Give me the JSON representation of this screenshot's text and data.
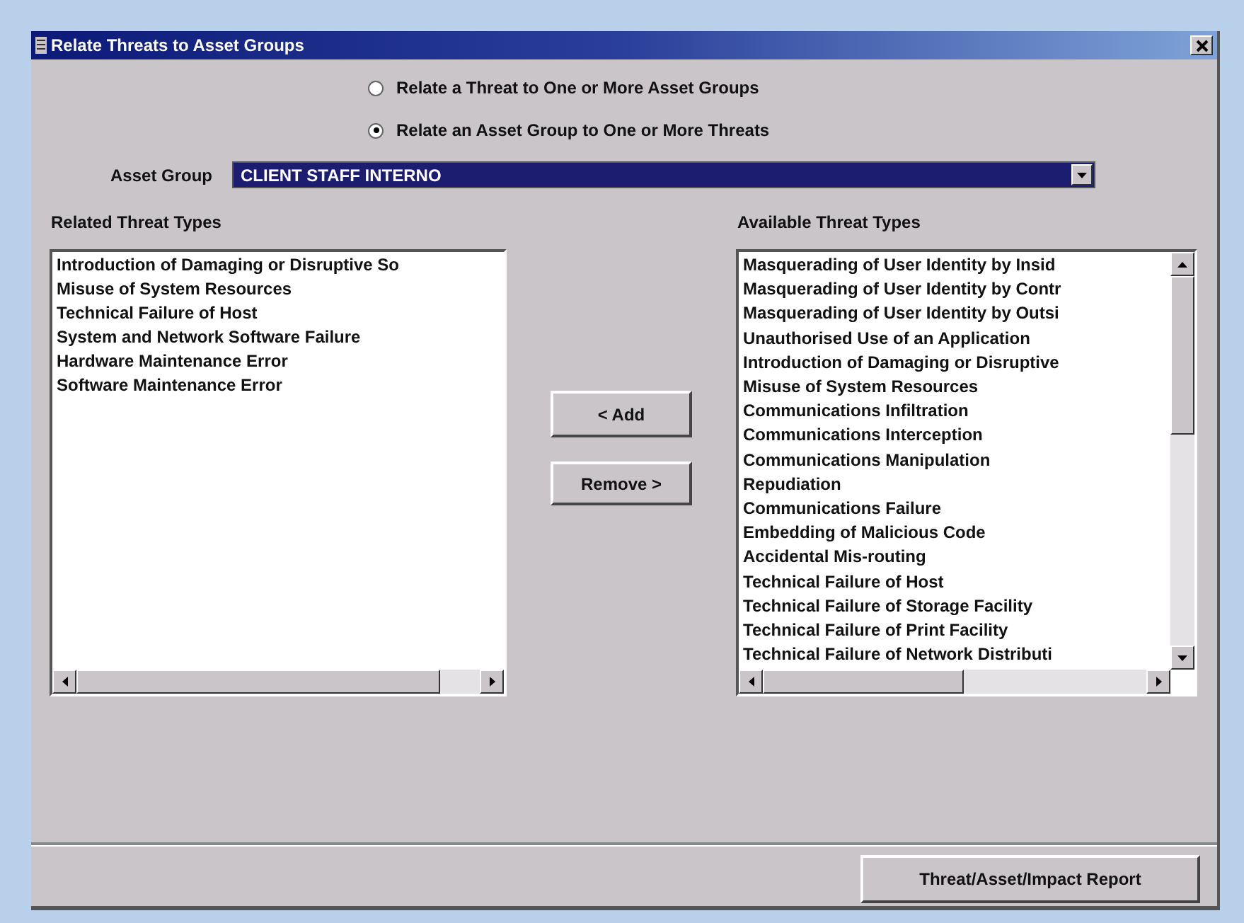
{
  "window": {
    "title": "Relate Threats to Asset Groups"
  },
  "modes": [
    {
      "label": "Relate a Threat to One or More Asset Groups",
      "selected": false
    },
    {
      "label": "Relate an Asset Group to One or More Threats",
      "selected": true
    }
  ],
  "asset_group": {
    "label": "Asset Group",
    "value": "CLIENT STAFF INTERNO"
  },
  "related": {
    "heading": "Related Threat Types",
    "items": [
      "Introduction of Damaging or Disruptive So",
      "Misuse of System Resources",
      "Technical Failure of Host",
      "System and Network Software Failure",
      "Hardware Maintenance Error",
      "Software Maintenance Error"
    ]
  },
  "actions": [
    "< Add",
    "Remove >"
  ],
  "available": {
    "heading": "Available Threat Types",
    "items": [
      "Masquerading of User Identity by Insid",
      "Masquerading of User Identity by Contr",
      "Masquerading of User Identity by Outsi",
      "Unauthorised Use of an Application",
      "Introduction of Damaging or Disruptive",
      "Misuse of System Resources",
      "Communications Infiltration",
      "Communications Interception",
      "Communications Manipulation",
      "Repudiation",
      "Communications Failure",
      "Embedding of Malicious Code",
      "Accidental Mis-routing",
      "Technical Failure of Host",
      "Technical Failure of Storage Facility",
      "Technical Failure of Print Facility",
      "Technical Failure of Network Distributi"
    ]
  },
  "report_button": "Threat/Asset/Impact Report"
}
